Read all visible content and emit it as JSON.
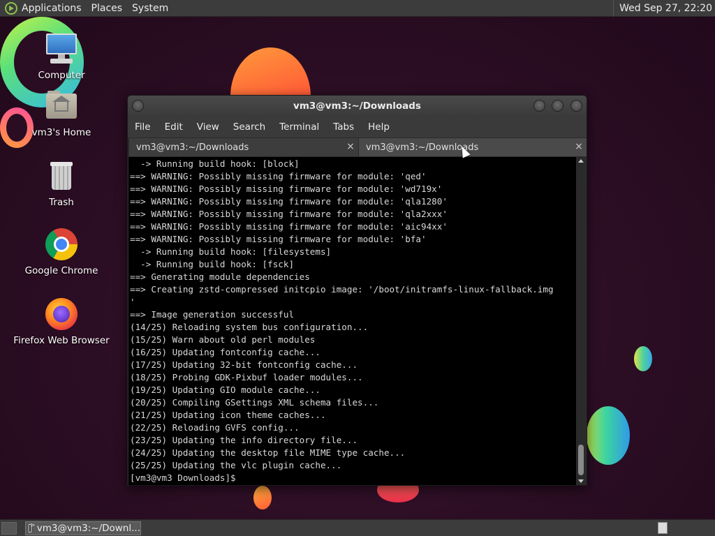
{
  "top_panel": {
    "menus": [
      "Applications",
      "Places",
      "System"
    ],
    "clock": "Wed Sep 27, 22:20"
  },
  "desktop_icons": [
    {
      "label": "Computer",
      "icon": "computer-icon"
    },
    {
      "label": "vm3's Home",
      "icon": "home-folder-icon"
    },
    {
      "label": "Trash",
      "icon": "trash-icon"
    },
    {
      "label": "Google Chrome",
      "icon": "chrome-icon"
    },
    {
      "label": "Firefox Web Browser",
      "icon": "firefox-icon"
    }
  ],
  "terminal": {
    "title": "vm3@vm3:~/Downloads",
    "menus": [
      "File",
      "Edit",
      "View",
      "Search",
      "Terminal",
      "Tabs",
      "Help"
    ],
    "tabs": [
      {
        "label": "vm3@vm3:~/Downloads",
        "close": "×"
      },
      {
        "label": "vm3@vm3:~/Downloads",
        "close": "×"
      }
    ],
    "lines": [
      "  -> Running build hook: [block]",
      "==> WARNING: Possibly missing firmware for module: 'qed'",
      "==> WARNING: Possibly missing firmware for module: 'wd719x'",
      "==> WARNING: Possibly missing firmware for module: 'qla1280'",
      "==> WARNING: Possibly missing firmware for module: 'qla2xxx'",
      "==> WARNING: Possibly missing firmware for module: 'aic94xx'",
      "==> WARNING: Possibly missing firmware for module: 'bfa'",
      "  -> Running build hook: [filesystems]",
      "  -> Running build hook: [fsck]",
      "==> Generating module dependencies",
      "==> Creating zstd-compressed initcpio image: '/boot/initramfs-linux-fallback.img",
      "'",
      "==> Image generation successful",
      "(14/25) Reloading system bus configuration...",
      "(15/25) Warn about old perl modules",
      "(16/25) Updating fontconfig cache...",
      "(17/25) Updating 32-bit fontconfig cache...",
      "(18/25) Probing GDK-Pixbuf loader modules...",
      "(19/25) Updating GIO module cache...",
      "(20/25) Compiling GSettings XML schema files...",
      "(21/25) Updating icon theme caches...",
      "(22/25) Reloading GVFS config...",
      "(23/25) Updating the info directory file...",
      "(24/25) Updating the desktop file MIME type cache...",
      "(25/25) Updating the vlc plugin cache...",
      "[vm3@vm3 Downloads]$ "
    ]
  },
  "bottom_panel": {
    "task_label": "vm3@vm3:~/Downl..."
  }
}
